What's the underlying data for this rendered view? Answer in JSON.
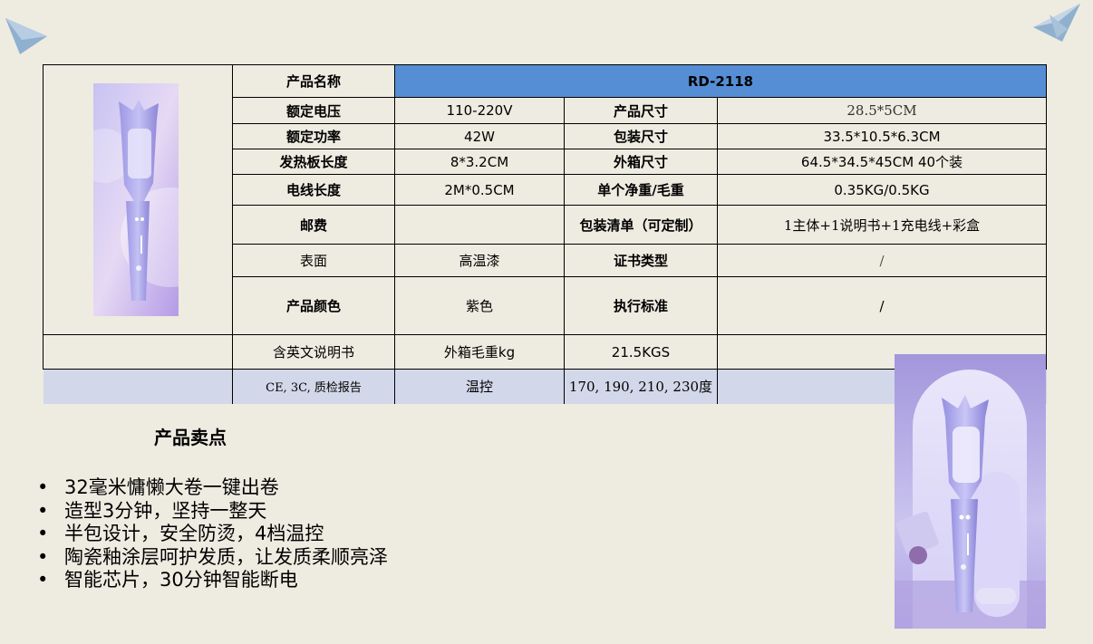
{
  "table": {
    "title_label": "产品名称",
    "title_value": "RD-2118",
    "rows": [
      {
        "l1": "额定电压",
        "v1": "110-220V",
        "l2": "产品尺寸",
        "v2": "28.5*5CM"
      },
      {
        "l1": "额定功率",
        "v1": "42W",
        "l2": "包装尺寸",
        "v2": "33.5*10.5*6.3CM"
      },
      {
        "l1": "发热板长度",
        "v1": "8*3.2CM",
        "l2": "外箱尺寸",
        "v2": "64.5*34.5*45CM 40个装"
      },
      {
        "l1": "电线长度",
        "v1": "2M*0.5CM",
        "l2": "单个净重/毛重",
        "v2": "0.35KG/0.5KG"
      },
      {
        "l1": "邮费",
        "v1": "",
        "l2": "包装清单（可定制）",
        "v2": "1主体+1说明书+1充电线+彩盒"
      },
      {
        "l1": "表面",
        "v1": "高温漆",
        "l2": "证书类型",
        "v2": "/"
      },
      {
        "l1": "产品颜色",
        "v1": "紫色",
        "l2": "执行标准",
        "v2": "/"
      }
    ],
    "extra_rows": [
      {
        "c1": "含英文说明书",
        "c2": "外箱毛重kg",
        "c3": "21.5KGS",
        "c4": ""
      },
      {
        "c1": "CE, 3C, 质检报告",
        "c2": "温控",
        "c3": "170, 190, 210, 230度",
        "c4": ""
      }
    ]
  },
  "selling_points": {
    "heading": "产品卖点",
    "items": [
      "32毫米慵懒大卷一键出卷",
      "造型3分钟，坚持一整天",
      "半包设计，安全防烫，4档温控",
      "陶瓷釉涂层呵护发质，让发质柔顺亮泽",
      "智能芯片，30分钟智能断电"
    ]
  },
  "colors": {
    "background": "#eeebe1",
    "title_band": "#558ed5",
    "last_row_band": "#d2d7e9",
    "product_purple": "#a9a2e8"
  }
}
